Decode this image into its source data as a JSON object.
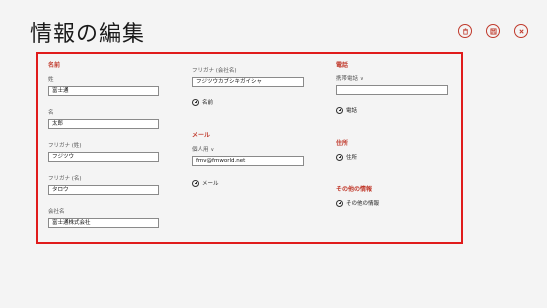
{
  "page": {
    "title": "情報の編集"
  },
  "toolbar": {
    "delete_icon": "trash-icon",
    "save_icon": "save-icon",
    "cancel_icon": "close-icon"
  },
  "name_section": {
    "title": "名前",
    "fields": [
      {
        "label": "姓",
        "value": "富士通"
      },
      {
        "label": "名",
        "value": "太郎"
      },
      {
        "label": "フリガナ (姓)",
        "value": "フジツウ"
      },
      {
        "label": "フリガナ (名)",
        "value": "タロウ"
      },
      {
        "label": "会社名",
        "value": "富士通株式会社"
      }
    ]
  },
  "company_kana": {
    "label": "フリガナ (会社名)",
    "value": "フジツウカブシキガイシャ"
  },
  "add_name": "名前",
  "mail_section": {
    "title": "メール",
    "type_label": "個人用",
    "value": "fmv@fmworld.net",
    "add_label": "メール"
  },
  "phone_section": {
    "title": "電話",
    "type_label": "携帯電話",
    "value": "",
    "add_label": "電話"
  },
  "address_section": {
    "title": "住所",
    "add_label": "住所"
  },
  "other_section": {
    "title": "その他の情報",
    "add_label": "その他の情報"
  },
  "colors": {
    "accent": "#c0392b",
    "frame": "#e01b1b",
    "background": "#f4f4f4"
  }
}
